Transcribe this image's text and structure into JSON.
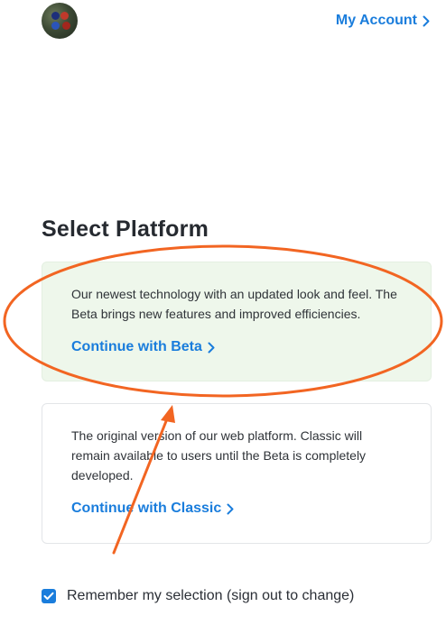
{
  "header": {
    "account_label": "My Account",
    "avatar_icon": "user-avatar"
  },
  "main": {
    "title": "Select Platform",
    "platforms": [
      {
        "id": "beta",
        "description": "Our newest technology with an updated look and feel. The Beta brings new features and improved efficiencies.",
        "link_label": "Continue with Beta",
        "highlighted": true
      },
      {
        "id": "classic",
        "description": "The original version of our web platform. Classic will remain available to users until the Beta is completely developed.",
        "link_label": "Continue with Classic",
        "highlighted": false
      }
    ]
  },
  "remember": {
    "label": "Remember my selection (sign out to change)",
    "checked": true
  },
  "colors": {
    "accent": "#1a7ddc",
    "beta_card_bg": "#eef7eb",
    "annotation": "#f26522"
  },
  "icons": {
    "chevron": "chevron-right-icon",
    "check": "check-icon"
  }
}
